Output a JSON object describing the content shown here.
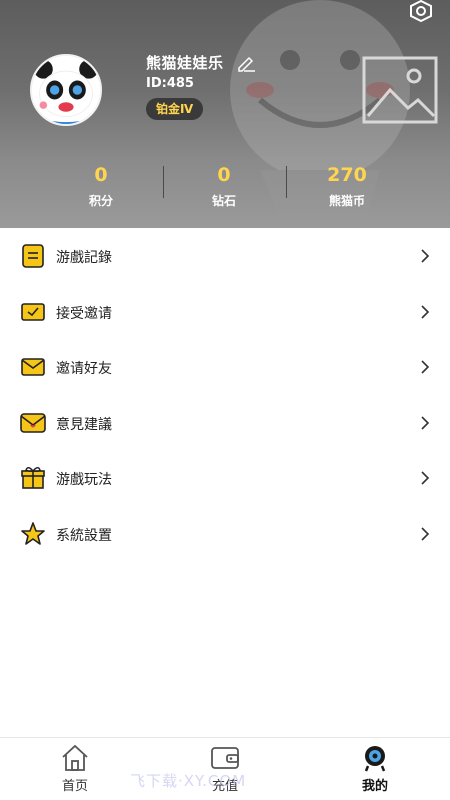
{
  "profile": {
    "name": "熊猫娃娃乐",
    "id": "ID:485",
    "rank": "铂金Ⅳ"
  },
  "stats": [
    {
      "value": "0",
      "label": "积分"
    },
    {
      "value": "0",
      "label": "钻石"
    },
    {
      "value": "270",
      "label": "熊猫币"
    }
  ],
  "menu": [
    {
      "label": "游戲記錄",
      "icon": "game-record-icon"
    },
    {
      "label": "接受邀请",
      "icon": "accept-invite-icon"
    },
    {
      "label": "邀请好友",
      "icon": "invite-friend-icon"
    },
    {
      "label": "意見建議",
      "icon": "feedback-icon"
    },
    {
      "label": "游戲玩法",
      "icon": "gameplay-icon"
    },
    {
      "label": "系統設置",
      "icon": "system-settings-icon"
    }
  ],
  "nav": [
    {
      "label": "首页",
      "icon": "home-icon"
    },
    {
      "label": "充值",
      "icon": "wallet-icon"
    },
    {
      "label": "我的",
      "icon": "profile-icon"
    }
  ],
  "watermark": "飞下载·XY.COM",
  "colors": {
    "accent": "#ffd54f",
    "header_bg": "#6f6f6f",
    "menu_icon": "#f5c518"
  }
}
